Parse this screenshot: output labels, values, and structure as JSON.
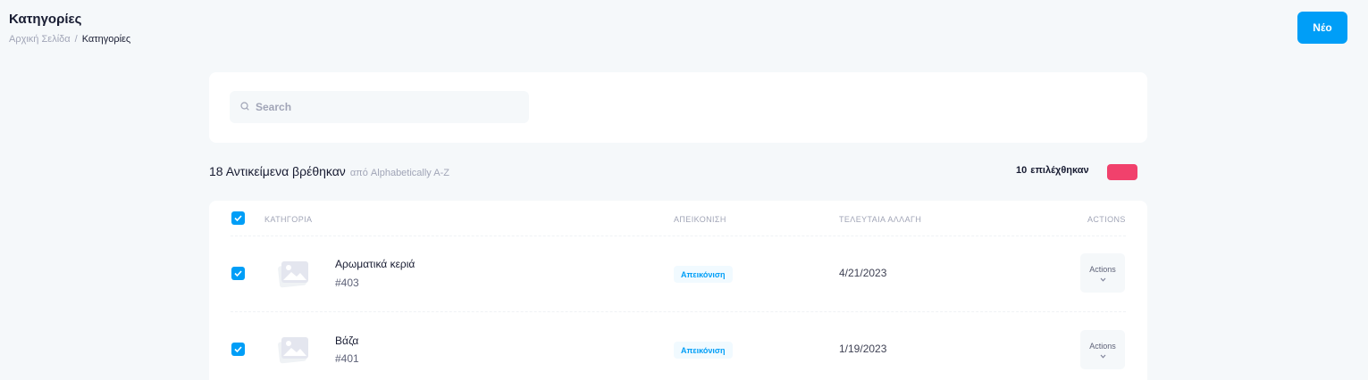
{
  "header": {
    "title": "Κατηγορίες",
    "breadcrumb": {
      "home": "Αρχική Σελίδα",
      "separator": "/",
      "current": "Κατηγορίες"
    },
    "new_button": "Νέο"
  },
  "search": {
    "placeholder": "Search",
    "value": ""
  },
  "summary": {
    "count_text": "18 Αντικείμενα βρέθηκαν",
    "sort_text": "από Alphabetically A-Z",
    "selected_count": "10",
    "selected_label": "επιλέχθηκαν"
  },
  "table": {
    "columns": {
      "category": "ΚΑΤΗΓΟΡΙΑ",
      "display": "ΑΠΕΙΚΟΝΙΣΗ",
      "last_change": "ΤΕΛΕΥΤΑΙΑ ΑΛΛΑΓΗ",
      "actions": "ACTIONS"
    },
    "rows": [
      {
        "name": "Αρωματικά κεριά",
        "id": "#403",
        "badge": "Απεικόνιση",
        "date": "4/21/2023",
        "actions_label": "Actions",
        "checked": true
      },
      {
        "name": "Βάζα",
        "id": "#401",
        "badge": "Απεικόνιση",
        "date": "1/19/2023",
        "actions_label": "Actions",
        "checked": true
      }
    ]
  },
  "colors": {
    "primary": "#009ef7",
    "danger": "#f1416c",
    "background": "#f5f8fa"
  },
  "icons": {
    "search": "search-icon",
    "check": "check-icon",
    "image_placeholder": "image-icon",
    "chevron": "chevron-down-icon"
  }
}
